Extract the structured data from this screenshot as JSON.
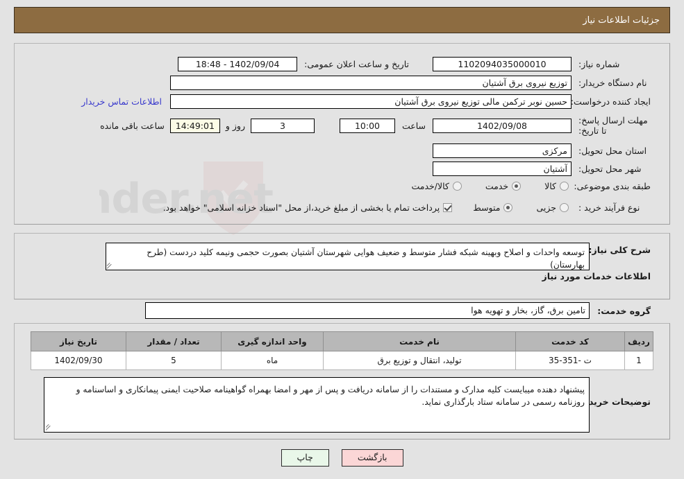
{
  "header": {
    "title": "جزئیات اطلاعات نیاز"
  },
  "watermark": {
    "text": "AriaTender.net"
  },
  "need_info": {
    "need_number": {
      "label": "شماره نیاز:",
      "value": "1102094035000010"
    },
    "announce_datetime": {
      "label": "تاریخ و ساعت اعلان عمومی:",
      "value": "1402/09/04 - 18:48"
    },
    "buyer_org": {
      "label": "نام دستگاه خریدار:",
      "value": "توزیع نیروی برق آشتیان"
    },
    "request_creator": {
      "label": "ایجاد کننده درخواست:",
      "value": "حسین  نوبر ترکمن  مالی توزیع نیروی برق آشتیان"
    },
    "buyer_contact_link": "اطلاعات تماس خریدار",
    "deadline": {
      "label": "مهلت ارسال پاسخ: تا تاریخ:",
      "date": "1402/09/08",
      "time_label": "ساعت",
      "time": "10:00",
      "days_remaining": "3",
      "days_label": "روز و",
      "countdown": "14:49:01",
      "countdown_label": "ساعت باقی مانده"
    },
    "delivery_province": {
      "label": "استان محل تحویل:",
      "value": "مرکزی"
    },
    "delivery_city": {
      "label": "شهر محل تحویل:",
      "value": "آشتیان"
    },
    "subject_category": {
      "label": "طبقه بندی موضوعی:",
      "options": [
        "کالا",
        "خدمت",
        "کالا/خدمت"
      ],
      "selected": "خدمت"
    },
    "purchase_process": {
      "label": "نوع فرآیند خرید :",
      "options": [
        "جزیی",
        "متوسط"
      ],
      "selected": "متوسط"
    },
    "treasury_note": {
      "checked": true,
      "text": "پرداخت تمام یا بخشی از مبلغ خرید،از محل \"اسناد خزانه اسلامی\" خواهد بود."
    }
  },
  "general_description": {
    "label": "شرح کلی نیاز:",
    "value": "توسعه واحدات و اصلاح وبهینه شبکه فشار متوسط و ضعیف هوایی شهرستان آشتیان بصورت حجمی ونیمه کلید دردست (طرح بهارستان)"
  },
  "services_section": {
    "heading": "اطلاعات خدمات مورد نیاز",
    "service_group": {
      "label": "گروه خدمت:",
      "value": "تامین برق، گاز، بخار و تهویه هوا"
    },
    "table": {
      "columns": [
        "ردیف",
        "کد خدمت",
        "نام خدمت",
        "واحد اندازه گیری",
        "تعداد / مقدار",
        "تاریخ نیاز"
      ],
      "rows": [
        {
          "row": "1",
          "code": "ت -351-35",
          "name": "تولید، انتقال و توزیع برق",
          "unit": "ماه",
          "quantity": "5",
          "need_date": "1402/09/30"
        }
      ]
    }
  },
  "buyer_notes": {
    "label": "توضیحات خریدار:",
    "value": "پیشنهاد دهنده میبایست کلیه مدارک و مستندات را از سامانه دریافت و پس از مهر و امضا بهمراه گواهینامه صلاحیت ایمنی پیمانکاری و اساسنامه و روزنامه رسمی در سامانه ستاد بارگذاری نماید."
  },
  "footer": {
    "print_label": "چاپ",
    "back_label": "بازگشت"
  },
  "colors": {
    "header_bg": "#8d6c41",
    "link": "#3838cc",
    "back_button_bg": "#fbd6d6",
    "print_button_bg": "#e9f7e9",
    "table_header_bg": "#b8b8b8",
    "page_bg": "#e3e3e3"
  }
}
